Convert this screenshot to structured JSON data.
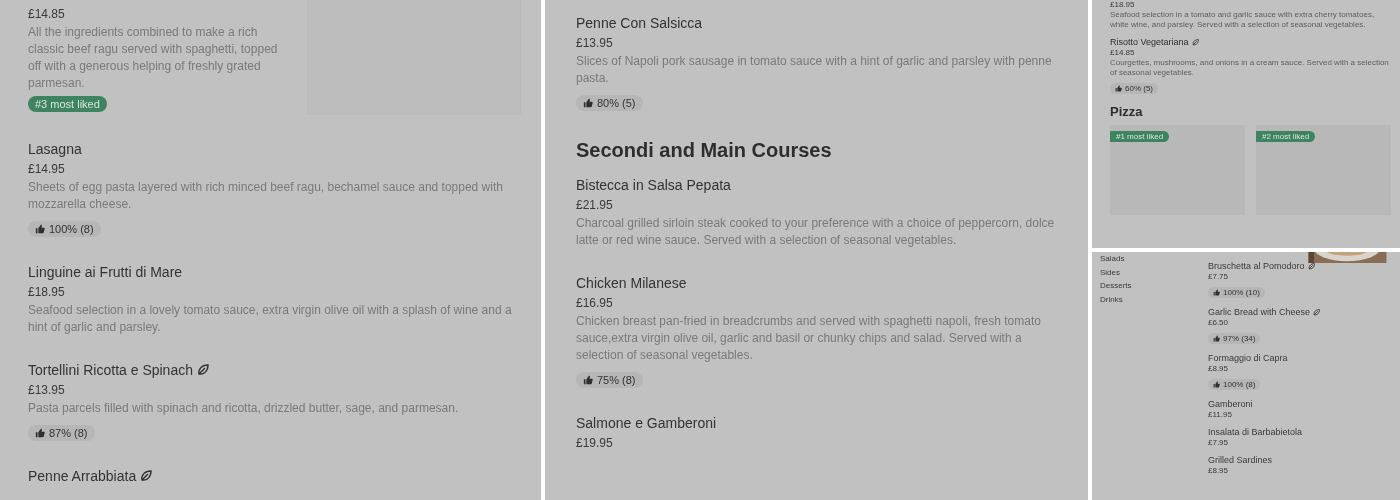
{
  "panels": [
    {
      "kind": "full",
      "sections": [
        {
          "items": [
            {
              "price": "£14.85",
              "description": "All the ingredients combined to make a rich classic beef ragu served with spaghetti, topped off with a generous helping of freshly grated parmesan.",
              "badge": "#3 most liked",
              "has_image": true,
              "vegetarian": false
            },
            {
              "name": "Lasagna",
              "price": "£14.95",
              "description": "Sheets of egg pasta layered with rich minced beef ragu, bechamel sauce and topped with mozzarella cheese.",
              "rating": "100% (8)",
              "vegetarian": false
            },
            {
              "name": "Linguine ai Frutti di Mare",
              "price": "£18.95",
              "description": "Seafood selection in a lovely tomato sauce, extra virgin olive oil with a splash of wine and a hint of garlic and parsley.",
              "vegetarian": false
            },
            {
              "name": "Tortellini Ricotta e Spinach",
              "price": "£13.95",
              "description": "Pasta parcels filled with spinach and ricotta, drizzled butter, sage, and parmesan.",
              "rating": "87% (8)",
              "vegetarian": true
            },
            {
              "name": "Penne Arrabbiata",
              "vegetarian": true
            }
          ]
        }
      ]
    },
    {
      "kind": "full",
      "sections": [
        {
          "items": [
            {
              "name": "Penne Con Salsicca",
              "price": "£13.95",
              "description": "Slices of Napoli pork sausage in tomato sauce with a hint of garlic and parsley with penne pasta.",
              "rating": "80% (5)",
              "vegetarian": false
            }
          ]
        },
        {
          "heading": "Secondi and Main Courses",
          "items": [
            {
              "name": "Bistecca in Salsa Pepata",
              "price": "£21.95",
              "description": "Charcoal grilled sirloin steak cooked to your preference with a choice of peppercorn, dolce latte or red wine sauce. Served with a selection of seasonal vegetables.",
              "vegetarian": false
            },
            {
              "name": "Chicken Milanese",
              "price": "£16.95",
              "description": "Chicken breast pan-fried in breadcrumbs and served with spaghetti napoli, fresh tomato sauce,extra virgin olive oil, garlic and basil or chunky chips and salad. Served with a selection of seasonal vegetables.",
              "rating": "75% (8)",
              "vegetarian": false
            },
            {
              "name": "Salmone e Gamberoni",
              "price": "£19.95",
              "vegetarian": false
            }
          ]
        }
      ]
    },
    {
      "kind": "compact",
      "sections": [
        {
          "items": [
            {
              "price": "£18.95",
              "description": "Seafood selection in a tomato and garlic sauce with extra cherry tomatoes, white wine, and parsley. Served with a selection of seasonal vegetables.",
              "vegetarian": false
            },
            {
              "name": "Risotto Vegetariana",
              "price": "£14.85",
              "description": "Courgettes, mushrooms, and onions in a cream sauce. Served with a selection of seasonal vegetables.",
              "rating": "60% (5)",
              "vegetarian": true
            }
          ]
        },
        {
          "heading": "Pizza",
          "cards": [
            {
              "badge": "#1 most liked"
            },
            {
              "badge": "#2 most liked"
            }
          ]
        }
      ]
    },
    {
      "kind": "tiny",
      "sidebar": [
        "Salads",
        "Sides",
        "Desserts",
        "Drinks"
      ],
      "photo": {
        "kind": "picture"
      },
      "sections": [
        {
          "items": [
            {
              "name": "Bruschetta al Pomodoro",
              "price": "£7.75",
              "rating": "100% (10)",
              "vegetarian": true
            },
            {
              "name": "Garlic Bread with Cheese",
              "price": "£6.50",
              "rating": "97% (34)",
              "vegetarian": true
            },
            {
              "name": "Formaggio di Capra",
              "price": "£8.95",
              "rating": "100% (8)",
              "vegetarian": false
            },
            {
              "name": "Gamberoni",
              "price": "£11.95",
              "vegetarian": false
            },
            {
              "name": "Insalata di Barbabietola",
              "price": "£7.95",
              "vegetarian": false
            },
            {
              "name": "Grilled Sardines",
              "price": "£8.95",
              "vegetarian": false
            }
          ]
        }
      ]
    }
  ]
}
